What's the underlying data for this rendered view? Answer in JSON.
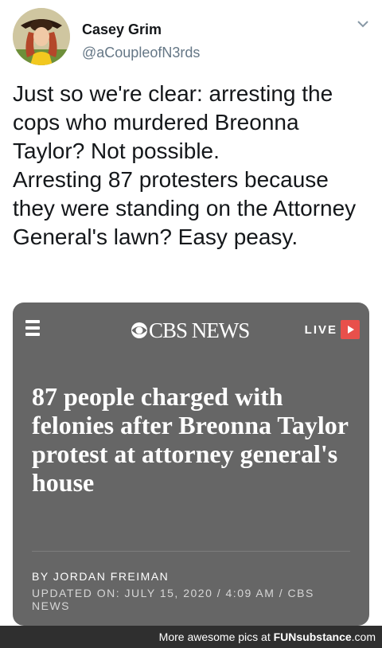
{
  "tweet": {
    "author_name": "Casey Grim",
    "author_handle": "@aCoupleofN3rds",
    "text": "Just so we're clear: arresting the cops who murdered Breonna Taylor? Not possible.\nArresting 87 protesters because they were standing on the Attorney General's lawn? Easy peasy."
  },
  "card": {
    "brand": "CBS NEWS",
    "live_label": "LIVE",
    "headline": "87 people charged with felonies after Breonna Taylor protest at attorney general's house",
    "byline": "BY JORDAN FREIMAN",
    "updated": "UPDATED ON: JULY 15, 2020 / 4:09 AM / CBS NEWS"
  },
  "footer": {
    "prefix": "More awesome pics at ",
    "brand": "FUNsubstance",
    "suffix": ".com"
  },
  "colors": {
    "card_bg": "#666666",
    "live_red": "#e8504b",
    "handle_gray": "#657786"
  }
}
